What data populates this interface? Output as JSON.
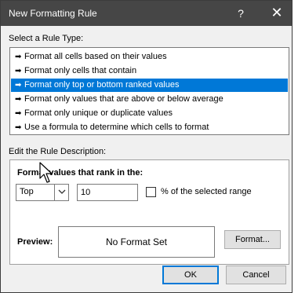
{
  "window": {
    "title": "New Formatting Rule",
    "help_label": "?",
    "close_label": "✕"
  },
  "rule_type": {
    "label": "Select a Rule Type:",
    "items": [
      {
        "label": "Format all cells based on their values",
        "selected": false
      },
      {
        "label": "Format only cells that contain",
        "selected": false
      },
      {
        "label": "Format only top or bottom ranked values",
        "selected": true
      },
      {
        "label": "Format only values that are above or below average",
        "selected": false
      },
      {
        "label": "Format only unique or duplicate values",
        "selected": false
      },
      {
        "label": "Use a formula to determine which cells to format",
        "selected": false
      }
    ],
    "arrow_glyph": "➡"
  },
  "description": {
    "label": "Edit the Rule Description:",
    "heading": "Format values that rank in the:",
    "rank_select": {
      "value": "Top"
    },
    "rank_count": {
      "value": "10"
    },
    "percent_checkbox": {
      "checked": false,
      "label": "% of the selected range"
    }
  },
  "preview": {
    "label": "Preview:",
    "text": "No Format Set",
    "format_button": "Format..."
  },
  "footer": {
    "ok_label": "OK",
    "cancel_label": "Cancel"
  },
  "colors": {
    "selection": "#0078d7",
    "titlebar": "#464646"
  },
  "icons": {
    "cursor": "mouse-pointer-icon",
    "dropdown": "chevron-down-icon",
    "close": "close-icon",
    "help": "help-icon"
  }
}
